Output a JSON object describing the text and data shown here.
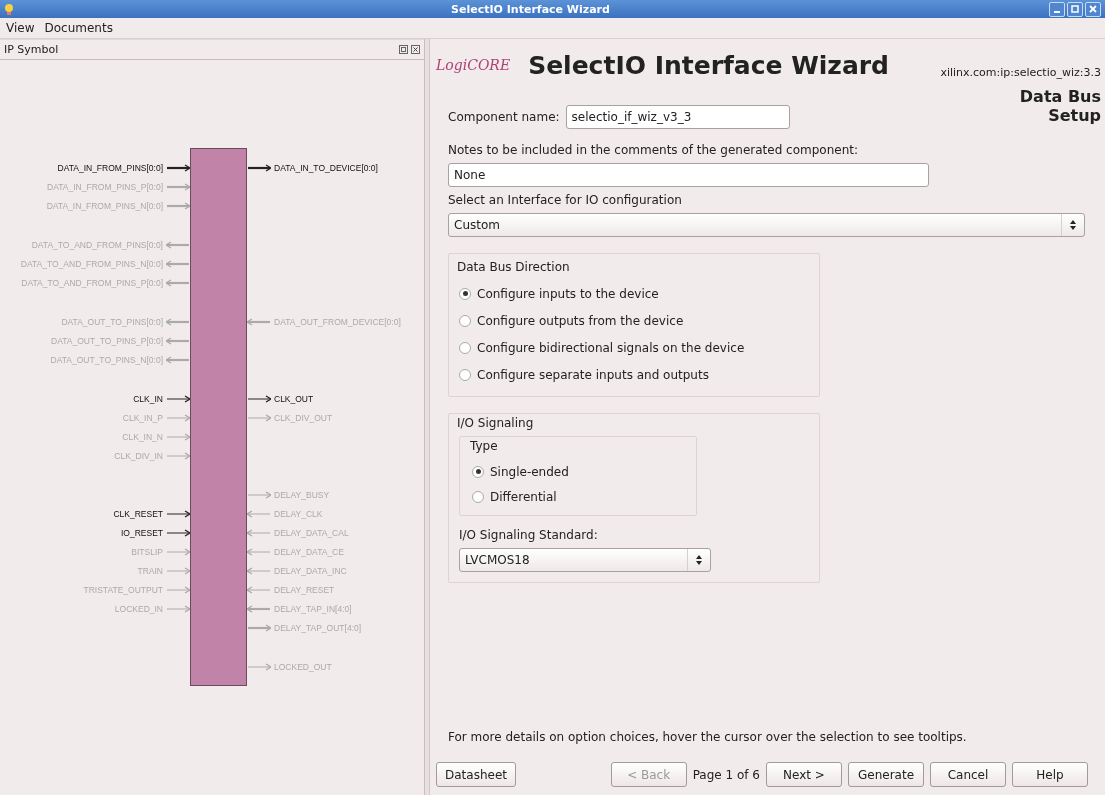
{
  "window": {
    "title": "SelectIO Interface Wizard"
  },
  "menu": [
    "View",
    "Documents"
  ],
  "ip_symbol": {
    "title": "IP Symbol",
    "groups": [
      {
        "rows": [
          {
            "left": {
              "name": "DATA_IN_FROM_PINS[0:0]",
              "active": true,
              "kind": "in",
              "bus": true
            },
            "right": {
              "name": "DATA_IN_TO_DEVICE[0:0]",
              "active": true,
              "kind": "out",
              "bus": true
            }
          },
          {
            "left": {
              "name": "DATA_IN_FROM_PINS_P[0:0]",
              "active": false,
              "kind": "in",
              "bus": true
            }
          },
          {
            "left": {
              "name": "DATA_IN_FROM_PINS_N[0:0]",
              "active": false,
              "kind": "in",
              "bus": true
            }
          }
        ]
      },
      {
        "rows": [
          {
            "left": {
              "name": "DATA_TO_AND_FROM_PINS[0:0]",
              "active": false,
              "kind": "inout",
              "bus": true
            }
          },
          {
            "left": {
              "name": "DATA_TO_AND_FROM_PINS_N[0:0]",
              "active": false,
              "kind": "inout",
              "bus": true
            }
          },
          {
            "left": {
              "name": "DATA_TO_AND_FROM_PINS_P[0:0]",
              "active": false,
              "kind": "inout",
              "bus": true
            }
          }
        ]
      },
      {
        "rows": [
          {
            "left": {
              "name": "DATA_OUT_TO_PINS[0:0]",
              "active": false,
              "kind": "out",
              "bus": true
            },
            "right": {
              "name": "DATA_OUT_FROM_DEVICE[0:0]",
              "active": false,
              "kind": "in",
              "bus": true
            }
          },
          {
            "left": {
              "name": "DATA_OUT_TO_PINS_P[0:0]",
              "active": false,
              "kind": "out",
              "bus": true
            }
          },
          {
            "left": {
              "name": "DATA_OUT_TO_PINS_N[0:0]",
              "active": false,
              "kind": "out",
              "bus": true
            }
          }
        ]
      },
      {
        "rows": [
          {
            "left": {
              "name": "CLK_IN",
              "active": true,
              "kind": "in",
              "bus": false
            },
            "right": {
              "name": "CLK_OUT",
              "active": true,
              "kind": "out",
              "bus": false
            }
          },
          {
            "left": {
              "name": "CLK_IN_P",
              "active": false,
              "kind": "in",
              "bus": false
            },
            "right": {
              "name": "CLK_DIV_OUT",
              "active": false,
              "kind": "out",
              "bus": false
            }
          },
          {
            "left": {
              "name": "CLK_IN_N",
              "active": false,
              "kind": "in",
              "bus": false
            }
          },
          {
            "left": {
              "name": "CLK_DIV_IN",
              "active": false,
              "kind": "in",
              "bus": false
            }
          }
        ]
      },
      {
        "rows": [
          {
            "right": {
              "name": "DELAY_BUSY",
              "active": false,
              "kind": "out",
              "bus": false
            }
          },
          {
            "left": {
              "name": "CLK_RESET",
              "active": true,
              "kind": "in",
              "bus": false
            },
            "right": {
              "name": "DELAY_CLK",
              "active": false,
              "kind": "in",
              "bus": false
            }
          },
          {
            "left": {
              "name": "IO_RESET",
              "active": true,
              "kind": "in",
              "bus": false
            },
            "right": {
              "name": "DELAY_DATA_CAL",
              "active": false,
              "kind": "in",
              "bus": false
            }
          },
          {
            "left": {
              "name": "BITSLIP",
              "active": false,
              "kind": "in",
              "bus": false
            },
            "right": {
              "name": "DELAY_DATA_CE",
              "active": false,
              "kind": "in",
              "bus": false
            }
          },
          {
            "left": {
              "name": "TRAIN",
              "active": false,
              "kind": "in",
              "bus": false
            },
            "right": {
              "name": "DELAY_DATA_INC",
              "active": false,
              "kind": "in",
              "bus": false
            }
          },
          {
            "left": {
              "name": "TRISTATE_OUTPUT",
              "active": false,
              "kind": "in",
              "bus": false
            },
            "right": {
              "name": "DELAY_RESET",
              "active": false,
              "kind": "in",
              "bus": false
            }
          },
          {
            "left": {
              "name": "LOCKED_IN",
              "active": false,
              "kind": "in",
              "bus": false
            },
            "right": {
              "name": "DELAY_TAP_IN[4:0]",
              "active": false,
              "kind": "in",
              "bus": true
            }
          },
          {
            "right": {
              "name": "DELAY_TAP_OUT[4:0]",
              "active": false,
              "kind": "out",
              "bus": true
            }
          }
        ]
      },
      {
        "rows": [
          {
            "right": {
              "name": "LOCKED_OUT",
              "active": false,
              "kind": "out",
              "bus": false
            }
          }
        ]
      }
    ]
  },
  "header": {
    "logo": "LogiCORE",
    "title": "SelectIO Interface Wizard",
    "vlnv": "xilinx.com:ip:selectio_wiz:3.3",
    "page_title": "Data Bus Setup"
  },
  "component_name": {
    "label": "Component name:",
    "value": "selectio_if_wiz_v3_3"
  },
  "notes": {
    "label": "Notes to be included in the comments of the generated component:",
    "value": "None"
  },
  "interface": {
    "label": "Select an Interface for IO configuration",
    "value": "Custom"
  },
  "data_bus_direction": {
    "title": "Data Bus Direction",
    "options": [
      {
        "label": "Configure inputs to the device",
        "selected": true
      },
      {
        "label": "Configure outputs from the device",
        "selected": false
      },
      {
        "label": "Configure bidirectional signals on the device",
        "selected": false
      },
      {
        "label": "Configure separate inputs and outputs",
        "selected": false
      }
    ]
  },
  "io_signaling": {
    "title": "I/O Signaling",
    "type": {
      "title": "Type",
      "options": [
        {
          "label": "Single-ended",
          "selected": true
        },
        {
          "label": "Differential",
          "selected": false
        }
      ]
    },
    "standard": {
      "label": "I/O Signaling Standard:",
      "value": "LVCMOS18"
    }
  },
  "hint": "For more details on option choices, hover the cursor over the selection to see tooltips.",
  "footer": {
    "datasheet": "Datasheet",
    "back": {
      "label": "< Back",
      "disabled": true
    },
    "page": "Page 1 of 6",
    "buttons": [
      "Next >",
      "Generate",
      "Cancel",
      "Help"
    ]
  }
}
